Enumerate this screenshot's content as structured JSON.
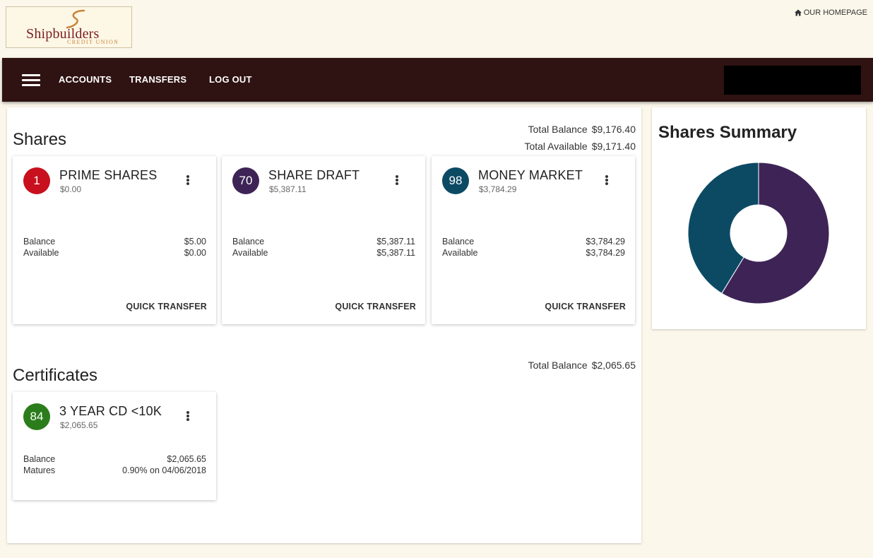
{
  "logo": {
    "name": "Shipbuilders",
    "sub": "CREDIT UNION"
  },
  "header": {
    "homepage_label": "OUR HOMEPAGE"
  },
  "nav": {
    "accounts": "ACCOUNTS",
    "transfers": "TRANSFERS",
    "logout": "LOG OUT"
  },
  "shares": {
    "title": "Shares",
    "total_balance_label": "Total Balance",
    "total_balance": "$9,176.40",
    "total_available_label": "Total Available",
    "total_available": "$9,171.40",
    "cards": [
      {
        "number": "1",
        "name": "PRIME SHARES",
        "sub": "$0.00",
        "balance_label": "Balance",
        "balance": "$5.00",
        "available_label": "Available",
        "available": "$0.00",
        "action": "QUICK TRANSFER",
        "color": "#c8101e"
      },
      {
        "number": "70",
        "name": "SHARE DRAFT",
        "sub": "$5,387.11",
        "balance_label": "Balance",
        "balance": "$5,387.11",
        "available_label": "Available",
        "available": "$5,387.11",
        "action": "QUICK TRANSFER",
        "color": "#3e2456"
      },
      {
        "number": "98",
        "name": "MONEY MARKET",
        "sub": "$3,784.29",
        "balance_label": "Balance",
        "balance": "$3,784.29",
        "available_label": "Available",
        "available": "$3,784.29",
        "action": "QUICK TRANSFER",
        "color": "#0c4a64"
      }
    ]
  },
  "certificates": {
    "title": "Certificates",
    "total_balance_label": "Total Balance",
    "total_balance": "$2,065.65",
    "cards": [
      {
        "number": "84",
        "name": "3 YEAR CD <10K",
        "sub": "$2,065.65",
        "balance_label": "Balance",
        "balance": "$2,065.65",
        "matures_label": "Matures",
        "matures": "0.90% on 04/06/2018",
        "color": "#2b7d1b"
      }
    ]
  },
  "summary": {
    "title": "Shares Summary"
  },
  "chart_data": {
    "type": "pie",
    "categories": [
      "PRIME SHARES",
      "SHARE DRAFT",
      "MONEY MARKET"
    ],
    "values": [
      0.0,
      5387.11,
      3784.29
    ],
    "colors": [
      "#c8101e",
      "#3e2456",
      "#0c4a64"
    ],
    "donut": true,
    "title": "Shares Summary"
  }
}
